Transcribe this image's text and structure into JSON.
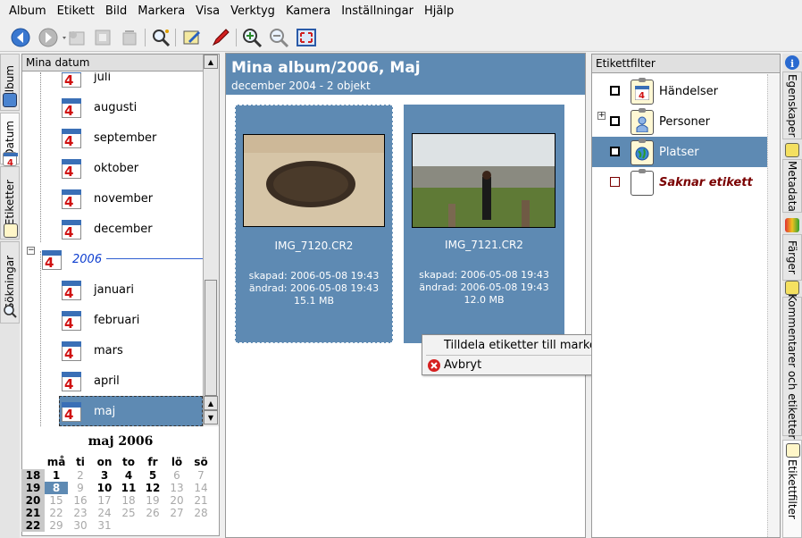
{
  "menubar": [
    "Album",
    "Etikett",
    "Bild",
    "Markera",
    "Visa",
    "Verktyg",
    "Kamera",
    "Inställningar",
    "Hjälp"
  ],
  "toolbar_icons": [
    "back-arrow-icon",
    "forward-arrow-icon",
    "new-album-icon",
    "add-images-icon",
    "delete-album-icon",
    "search-icon",
    "edit-image-icon",
    "pencil-icon",
    "zoom-in-icon",
    "zoom-out-icon",
    "full-screen-icon"
  ],
  "left_tabs": [
    "Album",
    "Datum",
    "Etiketter",
    "Sökningar"
  ],
  "right_tabs": [
    "Egenskaper",
    "Metadata",
    "Färger",
    "Kommentarer och etiketter",
    "Etikettfilter"
  ],
  "left_panel": {
    "header": "Mina datum",
    "months_2005": [
      "juli",
      "augusti",
      "september",
      "oktober",
      "november",
      "december"
    ],
    "year": "2006",
    "months_2006": [
      "januari",
      "februari",
      "mars",
      "april",
      "maj"
    ],
    "selected": "maj"
  },
  "calendar": {
    "title": "maj 2006",
    "weekdays": [
      "må",
      "ti",
      "on",
      "to",
      "fr",
      "lö",
      "sö"
    ],
    "weeks": [
      "18",
      "19",
      "20",
      "21",
      "22"
    ],
    "days": [
      [
        "1",
        "2",
        "3",
        "4",
        "5",
        "6",
        "7"
      ],
      [
        "8",
        "9",
        "10",
        "11",
        "12",
        "13",
        "14"
      ],
      [
        "15",
        "16",
        "17",
        "18",
        "19",
        "20",
        "21"
      ],
      [
        "22",
        "23",
        "24",
        "25",
        "26",
        "27",
        "28"
      ],
      [
        "29",
        "30",
        "31"
      ]
    ],
    "bold_days": [
      "1",
      "3",
      "4",
      "5",
      "10",
      "11",
      "12"
    ],
    "selected_day": "8"
  },
  "main": {
    "title": "Mina album/2006, Maj",
    "subtitle": "december 2004 - 2 objekt",
    "items": [
      {
        "name": "IMG_7120.CR2",
        "created": "skapad: 2006-05-08 19:43",
        "modified": "ändrad:  2006-05-08 19:43",
        "size": "15.1 MB"
      },
      {
        "name": "IMG_7121.CR2",
        "created": "skapad: 2006-05-08 19:43",
        "modified": "ändrad:  2006-05-08 19:43",
        "size": "12.0 MB"
      }
    ]
  },
  "context_menu": {
    "assign": "Tilldela etiketter till markerade bilder",
    "cancel": "Avbryt"
  },
  "right_panel": {
    "header": "Etikettfilter",
    "tags": [
      "Händelser",
      "Personer",
      "Platser",
      "Saknar etikett"
    ]
  },
  "colors": {
    "accent": "#5e8ab3",
    "missing_tag": "#7a0000"
  }
}
